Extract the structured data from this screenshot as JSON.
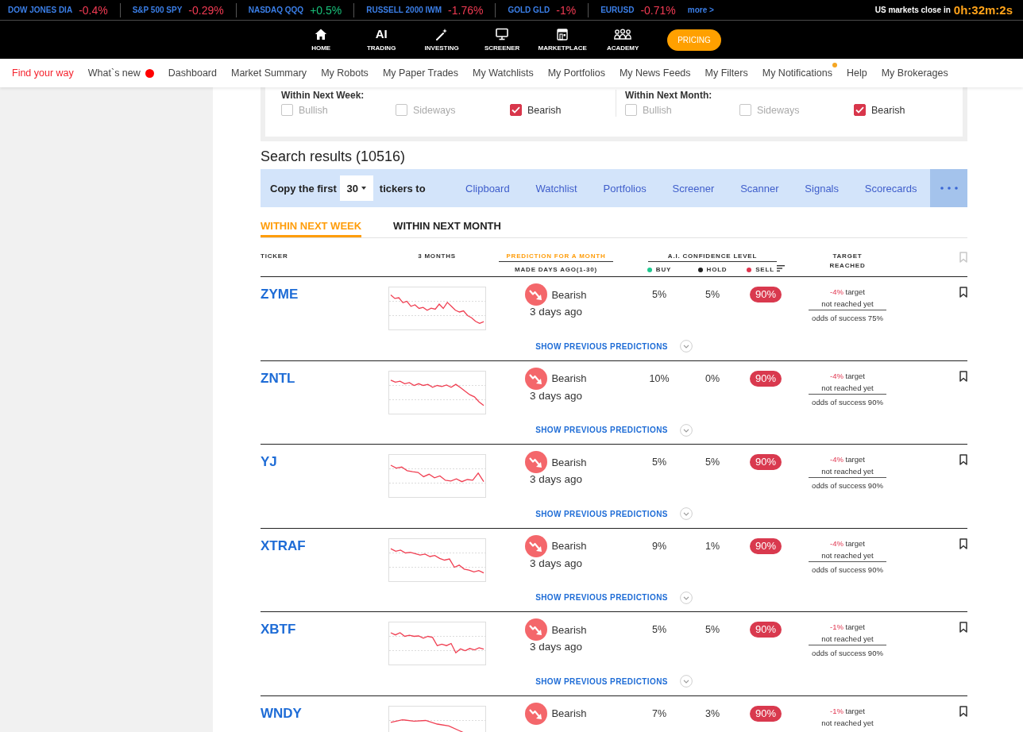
{
  "ticker_bar": {
    "quotes": [
      {
        "name": "DOW JONES DIA",
        "change": "-0.4%",
        "color": "#f23b53"
      },
      {
        "name": "S&P 500 SPY",
        "change": "-0.29%",
        "color": "#f23b53"
      },
      {
        "name": "NASDAQ QQQ",
        "change": "+0.5%",
        "color": "#18c07a"
      },
      {
        "name": "RUSSELL 2000 IWM",
        "change": "-1.76%",
        "color": "#f23b53"
      },
      {
        "name": "GOLD GLD",
        "change": "-1%",
        "color": "#f23b53"
      },
      {
        "name": "EURUSD",
        "change": "-0.71%",
        "color": "#f23b53"
      }
    ],
    "more": "more >",
    "countdown_label": "US markets close in",
    "countdown": "0h:32m:2s"
  },
  "main_nav": {
    "items": [
      {
        "label": "HOME"
      },
      {
        "glyph": "AI",
        "label": "TRADING"
      },
      {
        "label": "INVESTING"
      },
      {
        "label": "SCREENER"
      },
      {
        "label": "MARKETPLACE"
      },
      {
        "label": "ACADEMY"
      }
    ],
    "pricing": "PRICING"
  },
  "sub_nav": {
    "items": [
      {
        "label": "Find your way",
        "selected": true
      },
      {
        "label": "What`s new",
        "selected": false,
        "dot": {
          "kind": "inline",
          "color": "#ff0000"
        }
      },
      {
        "label": "Dashboard",
        "selected": false
      },
      {
        "label": "Market Summary",
        "selected": false
      },
      {
        "label": "My Robots",
        "selected": false
      },
      {
        "label": "My Paper Trades",
        "selected": false
      },
      {
        "label": "My Watchlists",
        "selected": false
      },
      {
        "label": "My Portfolios",
        "selected": false
      },
      {
        "label": "My News Feeds",
        "selected": false
      },
      {
        "label": "My Filters",
        "selected": false
      },
      {
        "label": "My Notifications",
        "selected": false,
        "dot": {
          "kind": "corner",
          "color": "#f5a623"
        }
      },
      {
        "label": "Help",
        "selected": false
      },
      {
        "label": "My Brokerages",
        "selected": false
      }
    ]
  },
  "filters": {
    "groups": [
      {
        "heading": "Within Next Week:",
        "options": [
          {
            "label": "Bullish",
            "checked": false
          },
          {
            "label": "Sideways",
            "checked": false
          },
          {
            "label": "Bearish",
            "checked": true
          }
        ]
      },
      {
        "heading": "Within Next Month:",
        "options": [
          {
            "label": "Bullish",
            "checked": false
          },
          {
            "label": "Sideways",
            "checked": false
          },
          {
            "label": "Bearish",
            "checked": true
          }
        ]
      }
    ]
  },
  "results": {
    "title": "Search results (10516)",
    "copy_bar": {
      "lead": "Copy the first",
      "count": "30",
      "trail": "tickers to",
      "targets": [
        "Clipboard",
        "Watchlist",
        "Portfolios",
        "Screener",
        "Scanner",
        "Signals",
        "Scorecards"
      ]
    },
    "tabs": [
      {
        "label": "WITHIN NEXT WEEK",
        "selected": true
      },
      {
        "label": "WITHIN NEXT MONTH",
        "selected": false
      }
    ],
    "table": {
      "columns": [
        {
          "kind": "text",
          "title": "TICKER"
        },
        {
          "kind": "text",
          "title": "3 MONTHS"
        },
        {
          "kind": "split",
          "title": "PREDICTION FOR A MONTH",
          "subtitle": "MADE DAYS AGO(1-30)"
        },
        {
          "kind": "legend",
          "title": "A.I. CONFIDENCE LEVEL",
          "legend": [
            {
              "label": "BUY",
              "color": "#1ec88f"
            },
            {
              "label": "HOLD",
              "color": "#222222"
            },
            {
              "label": "SELL",
              "color": "#e0354f"
            }
          ]
        },
        {
          "kind": "text",
          "title": "TARGET REACHED"
        }
      ],
      "rows": [
        {
          "ticker": "ZYME",
          "prediction": "Bearish",
          "made": "3 days ago",
          "confidence": [
            {
              "value": "5%",
              "highlighted": false
            },
            {
              "value": "5%",
              "highlighted": false
            },
            {
              "value": "90%",
              "highlighted": true
            }
          ],
          "target": {
            "change": "-4%",
            "label": "target",
            "status": "not reached yet",
            "odds": "odds of success 75%"
          },
          "bookmarked": false,
          "expand_link": "SHOW PREVIOUS PREDICTIONS"
        },
        {
          "ticker": "ZNTL",
          "prediction": "Bearish",
          "made": "3 days ago",
          "confidence": [
            {
              "value": "10%",
              "highlighted": false
            },
            {
              "value": "0%",
              "highlighted": false
            },
            {
              "value": "90%",
              "highlighted": true
            }
          ],
          "target": {
            "change": "-4%",
            "label": "target",
            "status": "not reached yet",
            "odds": "odds of success 90%"
          },
          "bookmarked": false,
          "expand_link": "SHOW PREVIOUS PREDICTIONS"
        },
        {
          "ticker": "YJ",
          "prediction": "Bearish",
          "made": "3 days ago",
          "confidence": [
            {
              "value": "5%",
              "highlighted": false
            },
            {
              "value": "5%",
              "highlighted": false
            },
            {
              "value": "90%",
              "highlighted": true
            }
          ],
          "target": {
            "change": "-4%",
            "label": "target",
            "status": "not reached yet",
            "odds": "odds of success 90%"
          },
          "bookmarked": false,
          "expand_link": "SHOW PREVIOUS PREDICTIONS"
        },
        {
          "ticker": "XTRAF",
          "prediction": "Bearish",
          "made": "3 days ago",
          "confidence": [
            {
              "value": "9%",
              "highlighted": false
            },
            {
              "value": "1%",
              "highlighted": false
            },
            {
              "value": "90%",
              "highlighted": true
            }
          ],
          "target": {
            "change": "-4%",
            "label": "target",
            "status": "not reached yet",
            "odds": "odds of success 90%"
          },
          "bookmarked": false,
          "expand_link": "SHOW PREVIOUS PREDICTIONS"
        },
        {
          "ticker": "XBTF",
          "prediction": "Bearish",
          "made": "3 days ago",
          "confidence": [
            {
              "value": "5%",
              "highlighted": false
            },
            {
              "value": "5%",
              "highlighted": false
            },
            {
              "value": "90%",
              "highlighted": true
            }
          ],
          "target": {
            "change": "-1%",
            "label": "target",
            "status": "not reached yet",
            "odds": "odds of success 90%"
          },
          "bookmarked": false,
          "expand_link": "SHOW PREVIOUS PREDICTIONS"
        },
        {
          "ticker": "WNDY",
          "prediction": "Bearish",
          "confidence": [
            {
              "value": "7%",
              "highlighted": false
            },
            {
              "value": "3%",
              "highlighted": false
            },
            {
              "value": "90%",
              "highlighted": true
            }
          ],
          "target": {
            "change": "-1%",
            "label": "target",
            "status": "not reached yet"
          },
          "bookmarked": false
        }
      ]
    }
  }
}
